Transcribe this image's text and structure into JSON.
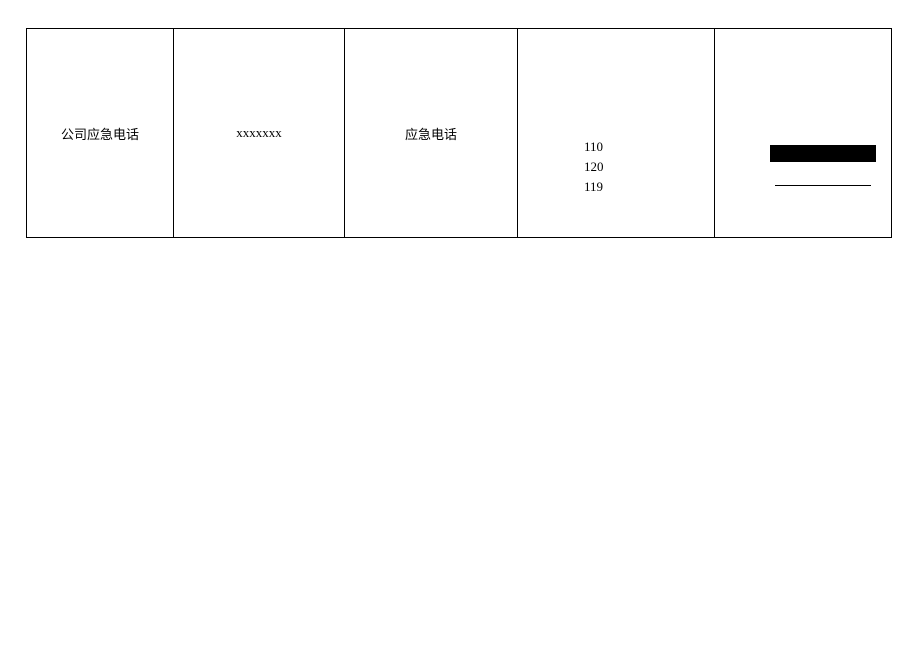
{
  "row": {
    "col1_label": "公司应急电话",
    "col2_value": "xxxxxxx",
    "col3_label": "应急电话",
    "col4_numbers": {
      "line1": "110",
      "line2": "120",
      "line3": "119"
    }
  }
}
